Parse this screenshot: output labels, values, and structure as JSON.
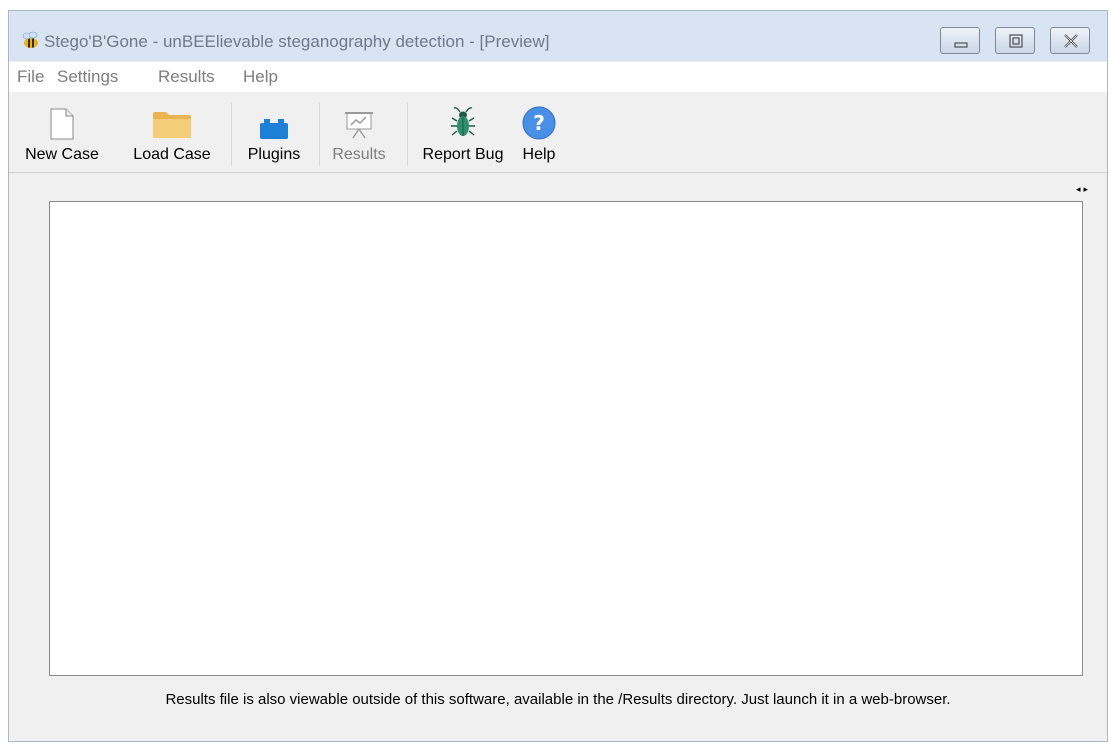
{
  "window": {
    "title": "Stego'B'Gone - unBEElievable steganography detection - [Preview]",
    "icon": "bee-icon"
  },
  "menu": {
    "file": "File",
    "settings": "Settings",
    "results": "Results",
    "help": "Help"
  },
  "toolbar": {
    "new_case": "New Case",
    "load_case": "Load Case",
    "plugins": "Plugins",
    "results": "Results",
    "report_bug": "Report Bug",
    "help": "Help"
  },
  "main": {
    "footer_note": "Results file is also viewable outside of this software, available in the /Results directory. Just launch it in a web-browser."
  },
  "colors": {
    "titlebar": "#d9e4f2",
    "disabled_text": "#7d7d7d",
    "plugins_blue": "#1e7fd6",
    "folder": "#f0c46a",
    "help_blue": "#4a8fe6",
    "bug_green": "#2f8f6f"
  }
}
